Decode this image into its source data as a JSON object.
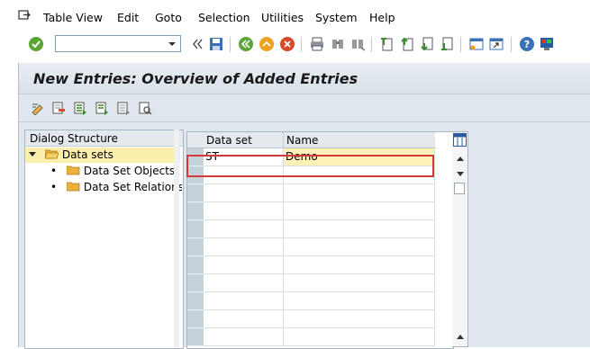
{
  "menu": {
    "items": [
      "Table View",
      "Edit",
      "Goto",
      "Selection",
      "Utilities",
      "System",
      "Help"
    ]
  },
  "toolbar": {
    "command_field_value": "",
    "icons": [
      "enter-check-icon",
      "command-field",
      "collapse-arrows-icon",
      "save-icon",
      "back-icon",
      "exit-icon",
      "cancel-icon",
      "print-icon",
      "find-icon",
      "find-next-icon",
      "first-page-icon",
      "previous-page-icon",
      "next-page-icon",
      "last-page-icon",
      "create-session-icon",
      "shortcut-icon",
      "help-icon",
      "customize-layout-icon"
    ]
  },
  "page": {
    "title": "New Entries: Overview of Added Entries"
  },
  "app_toolbar": {
    "icons": [
      "change-display-icon",
      "delete-icon",
      "select-all-icon",
      "select-block-icon",
      "deselect-all-icon",
      "where-used-icon"
    ]
  },
  "dialog_structure": {
    "header": "Dialog Structure",
    "nodes": [
      {
        "label": "Data sets",
        "level": 0,
        "expanded": true,
        "selected": true
      },
      {
        "label": "Data Set Objects",
        "level": 1,
        "expanded": false,
        "selected": false
      },
      {
        "label": "Data Set Relationship",
        "level": 1,
        "expanded": false,
        "selected": false
      }
    ]
  },
  "table": {
    "columns": [
      "Data set",
      "Name"
    ],
    "rows": [
      {
        "data_set": "ST",
        "name": "Demo"
      }
    ],
    "visible_row_count": 11
  },
  "colors": {
    "background": "#dfe6ec",
    "selected_node": "#fcefae",
    "highlight_border": "#d43a3a",
    "edit_cell": "#fdf1b8"
  }
}
